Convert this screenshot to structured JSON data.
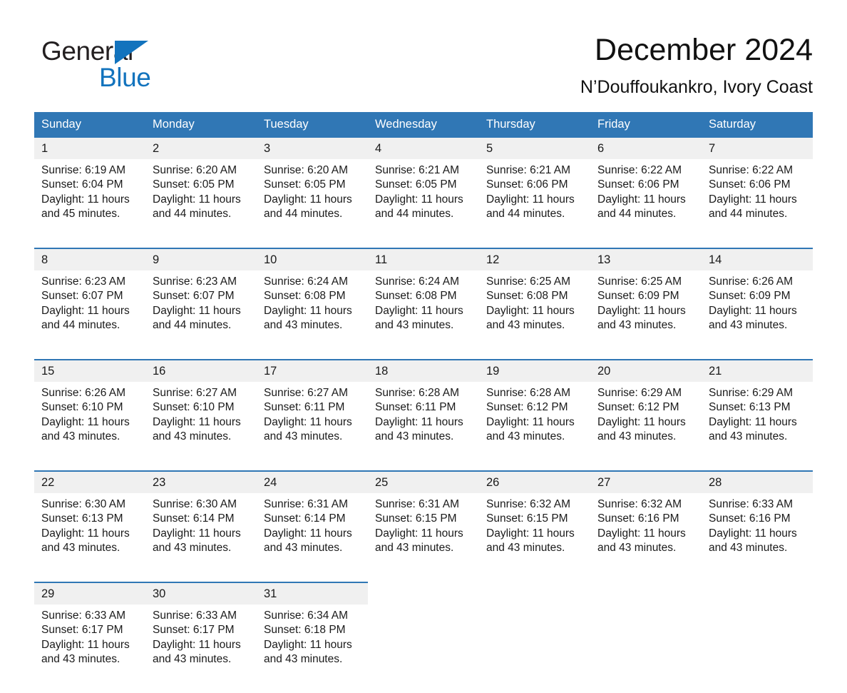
{
  "brand": {
    "line1": "General",
    "line2": "Blue",
    "triangle_color": "#1273bd"
  },
  "header": {
    "title": "December 2024",
    "subtitle": "N’Douffoukankro, Ivory Coast"
  },
  "theme": {
    "header_blue": "#3077b5",
    "daynum_band": "#f0f0f0",
    "cell_bg": "#ffffff",
    "text": "#1a1a1a"
  },
  "weekdays": [
    "Sunday",
    "Monday",
    "Tuesday",
    "Wednesday",
    "Thursday",
    "Friday",
    "Saturday"
  ],
  "weeks": [
    [
      {
        "day": "1",
        "sunrise": "Sunrise: 6:19 AM",
        "sunset": "Sunset: 6:04 PM",
        "daylight1": "Daylight: 11 hours",
        "daylight2": "and 45 minutes."
      },
      {
        "day": "2",
        "sunrise": "Sunrise: 6:20 AM",
        "sunset": "Sunset: 6:05 PM",
        "daylight1": "Daylight: 11 hours",
        "daylight2": "and 44 minutes."
      },
      {
        "day": "3",
        "sunrise": "Sunrise: 6:20 AM",
        "sunset": "Sunset: 6:05 PM",
        "daylight1": "Daylight: 11 hours",
        "daylight2": "and 44 minutes."
      },
      {
        "day": "4",
        "sunrise": "Sunrise: 6:21 AM",
        "sunset": "Sunset: 6:05 PM",
        "daylight1": "Daylight: 11 hours",
        "daylight2": "and 44 minutes."
      },
      {
        "day": "5",
        "sunrise": "Sunrise: 6:21 AM",
        "sunset": "Sunset: 6:06 PM",
        "daylight1": "Daylight: 11 hours",
        "daylight2": "and 44 minutes."
      },
      {
        "day": "6",
        "sunrise": "Sunrise: 6:22 AM",
        "sunset": "Sunset: 6:06 PM",
        "daylight1": "Daylight: 11 hours",
        "daylight2": "and 44 minutes."
      },
      {
        "day": "7",
        "sunrise": "Sunrise: 6:22 AM",
        "sunset": "Sunset: 6:06 PM",
        "daylight1": "Daylight: 11 hours",
        "daylight2": "and 44 minutes."
      }
    ],
    [
      {
        "day": "8",
        "sunrise": "Sunrise: 6:23 AM",
        "sunset": "Sunset: 6:07 PM",
        "daylight1": "Daylight: 11 hours",
        "daylight2": "and 44 minutes."
      },
      {
        "day": "9",
        "sunrise": "Sunrise: 6:23 AM",
        "sunset": "Sunset: 6:07 PM",
        "daylight1": "Daylight: 11 hours",
        "daylight2": "and 44 minutes."
      },
      {
        "day": "10",
        "sunrise": "Sunrise: 6:24 AM",
        "sunset": "Sunset: 6:08 PM",
        "daylight1": "Daylight: 11 hours",
        "daylight2": "and 43 minutes."
      },
      {
        "day": "11",
        "sunrise": "Sunrise: 6:24 AM",
        "sunset": "Sunset: 6:08 PM",
        "daylight1": "Daylight: 11 hours",
        "daylight2": "and 43 minutes."
      },
      {
        "day": "12",
        "sunrise": "Sunrise: 6:25 AM",
        "sunset": "Sunset: 6:08 PM",
        "daylight1": "Daylight: 11 hours",
        "daylight2": "and 43 minutes."
      },
      {
        "day": "13",
        "sunrise": "Sunrise: 6:25 AM",
        "sunset": "Sunset: 6:09 PM",
        "daylight1": "Daylight: 11 hours",
        "daylight2": "and 43 minutes."
      },
      {
        "day": "14",
        "sunrise": "Sunrise: 6:26 AM",
        "sunset": "Sunset: 6:09 PM",
        "daylight1": "Daylight: 11 hours",
        "daylight2": "and 43 minutes."
      }
    ],
    [
      {
        "day": "15",
        "sunrise": "Sunrise: 6:26 AM",
        "sunset": "Sunset: 6:10 PM",
        "daylight1": "Daylight: 11 hours",
        "daylight2": "and 43 minutes."
      },
      {
        "day": "16",
        "sunrise": "Sunrise: 6:27 AM",
        "sunset": "Sunset: 6:10 PM",
        "daylight1": "Daylight: 11 hours",
        "daylight2": "and 43 minutes."
      },
      {
        "day": "17",
        "sunrise": "Sunrise: 6:27 AM",
        "sunset": "Sunset: 6:11 PM",
        "daylight1": "Daylight: 11 hours",
        "daylight2": "and 43 minutes."
      },
      {
        "day": "18",
        "sunrise": "Sunrise: 6:28 AM",
        "sunset": "Sunset: 6:11 PM",
        "daylight1": "Daylight: 11 hours",
        "daylight2": "and 43 minutes."
      },
      {
        "day": "19",
        "sunrise": "Sunrise: 6:28 AM",
        "sunset": "Sunset: 6:12 PM",
        "daylight1": "Daylight: 11 hours",
        "daylight2": "and 43 minutes."
      },
      {
        "day": "20",
        "sunrise": "Sunrise: 6:29 AM",
        "sunset": "Sunset: 6:12 PM",
        "daylight1": "Daylight: 11 hours",
        "daylight2": "and 43 minutes."
      },
      {
        "day": "21",
        "sunrise": "Sunrise: 6:29 AM",
        "sunset": "Sunset: 6:13 PM",
        "daylight1": "Daylight: 11 hours",
        "daylight2": "and 43 minutes."
      }
    ],
    [
      {
        "day": "22",
        "sunrise": "Sunrise: 6:30 AM",
        "sunset": "Sunset: 6:13 PM",
        "daylight1": "Daylight: 11 hours",
        "daylight2": "and 43 minutes."
      },
      {
        "day": "23",
        "sunrise": "Sunrise: 6:30 AM",
        "sunset": "Sunset: 6:14 PM",
        "daylight1": "Daylight: 11 hours",
        "daylight2": "and 43 minutes."
      },
      {
        "day": "24",
        "sunrise": "Sunrise: 6:31 AM",
        "sunset": "Sunset: 6:14 PM",
        "daylight1": "Daylight: 11 hours",
        "daylight2": "and 43 minutes."
      },
      {
        "day": "25",
        "sunrise": "Sunrise: 6:31 AM",
        "sunset": "Sunset: 6:15 PM",
        "daylight1": "Daylight: 11 hours",
        "daylight2": "and 43 minutes."
      },
      {
        "day": "26",
        "sunrise": "Sunrise: 6:32 AM",
        "sunset": "Sunset: 6:15 PM",
        "daylight1": "Daylight: 11 hours",
        "daylight2": "and 43 minutes."
      },
      {
        "day": "27",
        "sunrise": "Sunrise: 6:32 AM",
        "sunset": "Sunset: 6:16 PM",
        "daylight1": "Daylight: 11 hours",
        "daylight2": "and 43 minutes."
      },
      {
        "day": "28",
        "sunrise": "Sunrise: 6:33 AM",
        "sunset": "Sunset: 6:16 PM",
        "daylight1": "Daylight: 11 hours",
        "daylight2": "and 43 minutes."
      }
    ],
    [
      {
        "day": "29",
        "sunrise": "Sunrise: 6:33 AM",
        "sunset": "Sunset: 6:17 PM",
        "daylight1": "Daylight: 11 hours",
        "daylight2": "and 43 minutes."
      },
      {
        "day": "30",
        "sunrise": "Sunrise: 6:33 AM",
        "sunset": "Sunset: 6:17 PM",
        "daylight1": "Daylight: 11 hours",
        "daylight2": "and 43 minutes."
      },
      {
        "day": "31",
        "sunrise": "Sunrise: 6:34 AM",
        "sunset": "Sunset: 6:18 PM",
        "daylight1": "Daylight: 11 hours",
        "daylight2": "and 43 minutes."
      },
      null,
      null,
      null,
      null
    ]
  ]
}
